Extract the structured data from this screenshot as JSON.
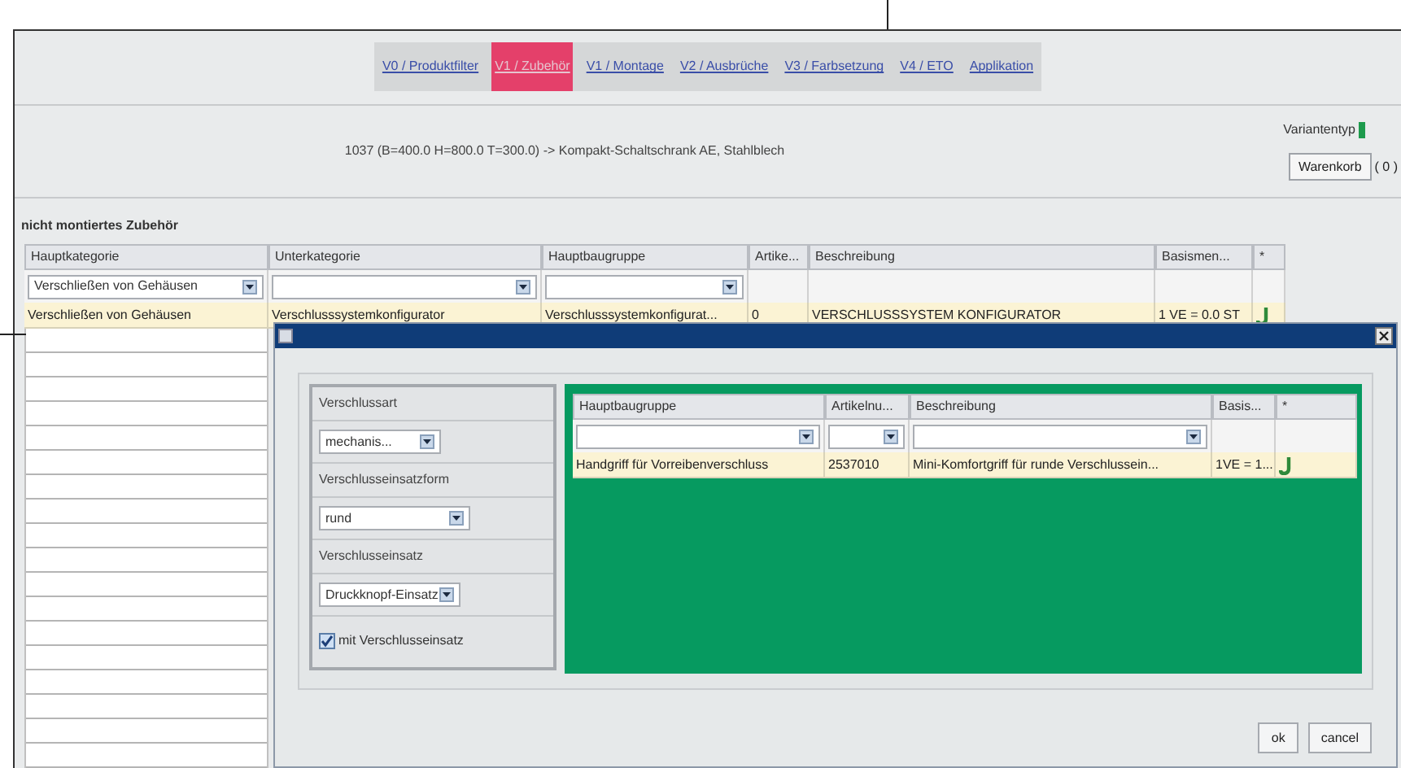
{
  "tabs": [
    {
      "label": "V0 / Produktfilter",
      "selected": false
    },
    {
      "label": "V1 / Zubehör",
      "selected": true
    },
    {
      "label": "V1 / Montage",
      "selected": false
    },
    {
      "label": "V2 / Ausbrüche",
      "selected": false
    },
    {
      "label": "V3 / Farbsetzung",
      "selected": false
    },
    {
      "label": "V4 / ETO",
      "selected": false
    },
    {
      "label": "Applikation",
      "selected": false
    }
  ],
  "header": {
    "description": "1037 (B=400.0 H=800.0 T=300.0) -> Kompakt-Schaltschrank AE, Stahlblech",
    "variant_type_label": "Variantentyp",
    "cart_button": "Warenkorb",
    "cart_count": "( 0 )"
  },
  "section_title": "nicht montiertes Zubehör",
  "table": {
    "columns": [
      "Hauptkategorie",
      "Unterkategorie",
      "Hauptbaugruppe",
      "Artike...",
      "Beschreibung",
      "Basismen...",
      "*"
    ],
    "filters": [
      {
        "kind": "dropdown",
        "value": "Verschließen von Gehäusen"
      },
      {
        "kind": "dropdown"
      },
      {
        "kind": "dropdown"
      },
      {
        "kind": "blank"
      },
      {
        "kind": "blank"
      },
      {
        "kind": "blank"
      },
      {
        "kind": "blank"
      }
    ],
    "rows": [
      {
        "selected": true,
        "cells": [
          "Verschließen von Gehäusen",
          "Verschlusssystemkonfigurator",
          "Verschlusssystemkonfigurat...",
          "0",
          "VERSCHLUSSSYSTEM KONFIGURATOR",
          "1 VE = 0.0 ST"
        ]
      }
    ]
  },
  "dialog": {
    "left_panel": [
      {
        "kind": "label",
        "text": "Verschlussart"
      },
      {
        "kind": "dropdown",
        "value": "mechanis..."
      },
      {
        "kind": "label",
        "text": "Verschlusseinsatzform"
      },
      {
        "kind": "dropdown",
        "value": "rund"
      },
      {
        "kind": "label",
        "text": "Verschlusseinsatz"
      },
      {
        "kind": "dropdown",
        "value": "Druckknopf-Einsatz"
      },
      {
        "kind": "checkbox",
        "text": "mit Verschlusseinsatz",
        "checked": true
      }
    ],
    "table": {
      "columns": [
        "Hauptbaugruppe",
        "Artikelnu...",
        "Beschreibung",
        "Basis...",
        "*"
      ],
      "filters": [
        {
          "kind": "dropdown"
        },
        {
          "kind": "dropdown"
        },
        {
          "kind": "dropdown"
        },
        {
          "kind": "blank"
        },
        {
          "kind": "blank"
        }
      ],
      "rows": [
        {
          "selected": true,
          "cells": [
            "Handgriff für Vorreibenverschluss",
            "2537010",
            "Mini-Komfortgriff für runde Verschlussein...",
            "1VE = 1..."
          ]
        }
      ]
    },
    "buttons": [
      "ok",
      "cancel"
    ]
  }
}
